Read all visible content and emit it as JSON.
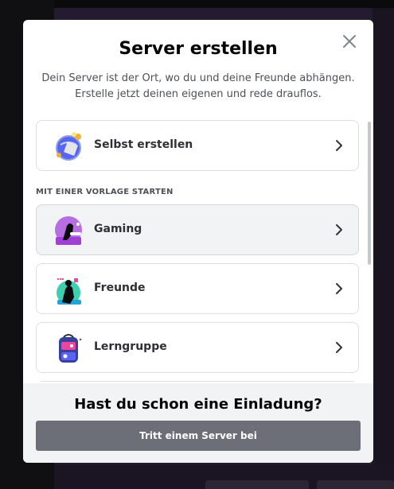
{
  "modal": {
    "title": "Server erstellen",
    "subtitle": "Dein Server ist der Ort, wo du und deine Freunde abhängen. Erstelle jetzt deinen eigenen und rede drauflos.",
    "close_icon": "close-icon"
  },
  "create_own": {
    "label": "Selbst erstellen",
    "icon": "globe-build-icon"
  },
  "template_section": {
    "label": "MIT EINER VORLAGE STARTEN"
  },
  "templates": [
    {
      "label": "Gaming",
      "icon": "gaming-icon"
    },
    {
      "label": "Freunde",
      "icon": "friends-icon"
    },
    {
      "label": "Lerngruppe",
      "icon": "study-group-icon"
    }
  ],
  "footer": {
    "title": "Hast du schon eine Einladung?",
    "join_label": "Tritt einem Server bei"
  },
  "colors": {
    "modal_bg": "#ffffff",
    "footer_bg": "#f2f3f5",
    "join_button": "#6d6f78",
    "backdrop": "#241b30"
  }
}
